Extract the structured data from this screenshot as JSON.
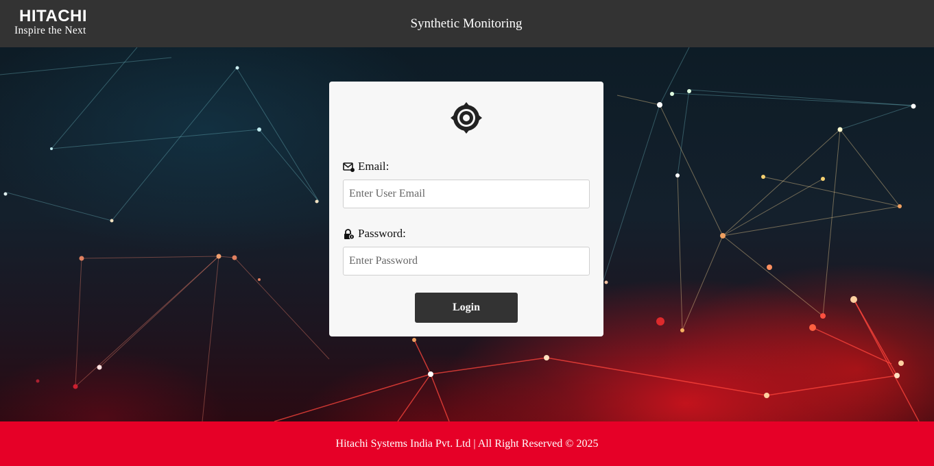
{
  "header": {
    "logo_main": "HITACHI",
    "logo_tagline": "Inspire the Next",
    "title": "Synthetic Monitoring"
  },
  "login": {
    "emblem_icon": "hitachi-emblem-icon",
    "email_icon": "mail-icon",
    "email_label": "Email:",
    "email_placeholder": "Enter User Email",
    "email_value": "",
    "password_icon": "lock-icon",
    "password_label": "Password:",
    "password_placeholder": "Enter Password",
    "password_value": "",
    "login_label": "Login"
  },
  "footer": {
    "text": "Hitachi Systems India Pvt. Ltd | All Right Reserved © 2025"
  },
  "colors": {
    "header_bg": "#333333",
    "footer_bg": "#e60027",
    "card_bg": "#f7f7f7",
    "button_bg": "#333333"
  }
}
